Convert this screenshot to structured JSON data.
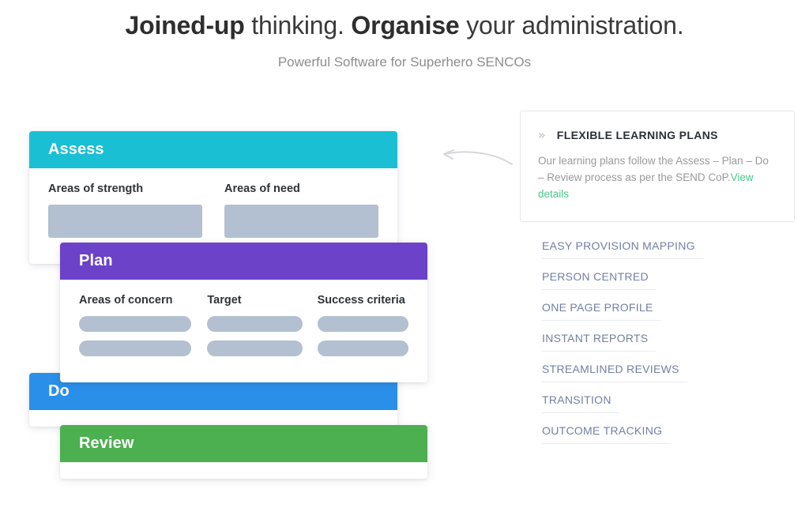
{
  "header": {
    "headline_part1_bold": "Joined-up",
    "headline_part2": " thinking. ",
    "headline_part3_bold": "Organise",
    "headline_part4": " your administration.",
    "subheadline": "Powerful Software for Superhero SENCOs"
  },
  "cards": [
    {
      "id": "assess",
      "title": "Assess",
      "color": "#1ABFD4",
      "columns": [
        {
          "label": "Areas of strength"
        },
        {
          "label": "Areas of need"
        }
      ]
    },
    {
      "id": "plan",
      "title": "Plan",
      "color": "#6B42C8",
      "columns": [
        {
          "label": "Areas of concern"
        },
        {
          "label": "Target"
        },
        {
          "label": "Success criteria"
        }
      ]
    },
    {
      "id": "do",
      "title": "Do",
      "color": "#2A8FE8",
      "columns": []
    },
    {
      "id": "review",
      "title": "Review",
      "color": "#4CAF50",
      "columns": []
    }
  ],
  "arrow": {
    "direction": "left",
    "color": "#d5d7da"
  },
  "info_box": {
    "chevron": "»",
    "title": "FLEXIBLE LEARNING PLANS",
    "description": "Our learning plans follow the Assess – Plan – Do – Review process as per the SEND CoP.",
    "link_label": "View details",
    "link_color": "#49c98a"
  },
  "feature_list": {
    "items": [
      {
        "label": "EASY PROVISION MAPPING"
      },
      {
        "label": "PERSON CENTRED"
      },
      {
        "label": "ONE PAGE PROFILE"
      },
      {
        "label": "INSTANT REPORTS"
      },
      {
        "label": "STREAMLINED REVIEWS"
      },
      {
        "label": "TRANSITION"
      },
      {
        "label": "OUTCOME TRACKING"
      }
    ],
    "text_color": "#7180a3"
  }
}
